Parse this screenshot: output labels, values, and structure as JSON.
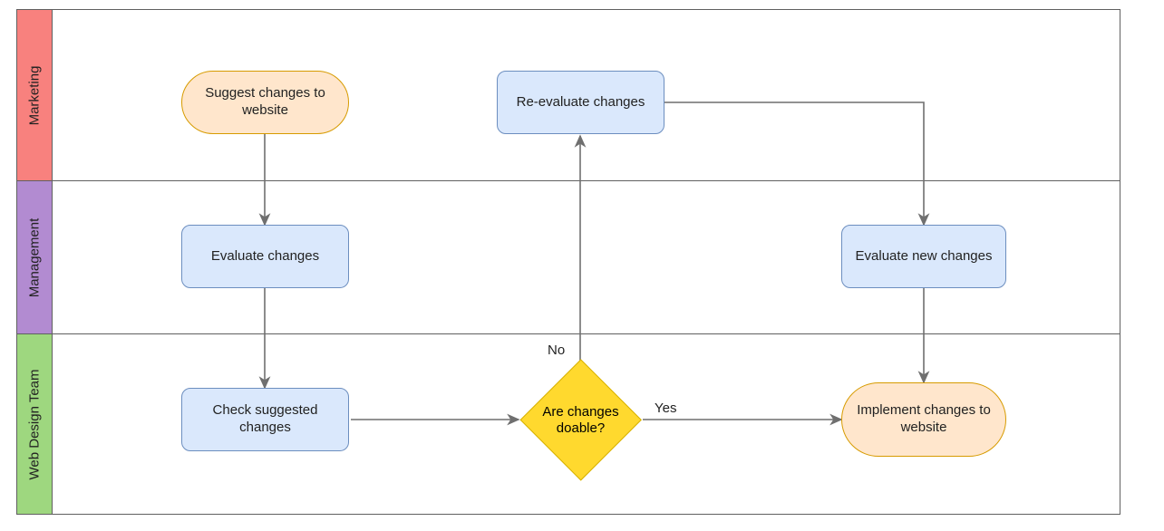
{
  "lanes": [
    {
      "id": "marketing",
      "label": "Marketing",
      "color": "#f8817e"
    },
    {
      "id": "management",
      "label": "Management",
      "color": "#b28bd1"
    },
    {
      "id": "webdesign",
      "label": "Web Design Team",
      "color": "#9ed77f"
    }
  ],
  "nodes": {
    "suggest": {
      "label": "Suggest changes to website"
    },
    "evaluate": {
      "label": "Evaluate changes"
    },
    "check": {
      "label": "Check suggested changes"
    },
    "decision": {
      "label": "Are changes doable?"
    },
    "reevaluate": {
      "label": "Re-evaluate changes"
    },
    "evalnew": {
      "label": "Evaluate new changes"
    },
    "implement": {
      "label": "Implement changes to website"
    }
  },
  "edgeLabels": {
    "no": "No",
    "yes": "Yes"
  }
}
